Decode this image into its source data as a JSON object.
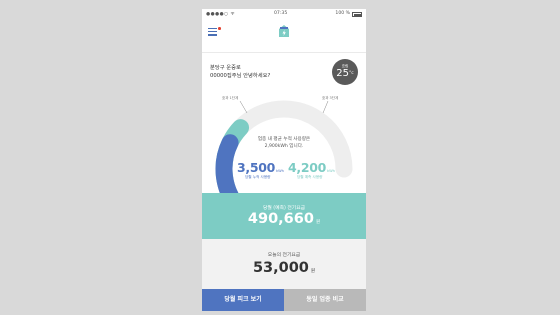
{
  "status_bar": {
    "signal": "●●●●○ ᯤ",
    "time": "07:35",
    "battery": "100 %"
  },
  "header": {
    "logo_icon": "house-bolt-icon",
    "menu_icon": "hamburger-menu-icon"
  },
  "greeting": {
    "line1": "분당구 운중로",
    "line2": "00000집주님 안녕하세요?"
  },
  "weather": {
    "label": "흐림",
    "temp": "25",
    "unit": "°c"
  },
  "gauge": {
    "tick_low": "호과 1단계",
    "tick_high": "호과 3단계",
    "info_line1": "업종 내 평균 누적 사용량은",
    "info_line2": "2,900kWh 입니다.",
    "my_value": "3,500",
    "my_unit": "kWh",
    "my_label": "당월 누적 사용량",
    "avg_value": "4,200",
    "avg_unit": "kWh",
    "avg_label": "당월 예측 사용량",
    "blue_fraction": 0.3,
    "teal_fraction": 0.38,
    "colors": {
      "blue": "#4f74c0",
      "teal": "#7dccc4",
      "track": "#eeeeee"
    }
  },
  "forecast_bill": {
    "label": "당월 (예측) 전기요금",
    "amount": "490,660",
    "unit": "원"
  },
  "today_bill": {
    "label": "오늘의 전기요금",
    "amount": "53,000",
    "unit": "원"
  },
  "buttons": {
    "peak": "당월 피크 보기",
    "compare": "동일 업종 비교"
  }
}
